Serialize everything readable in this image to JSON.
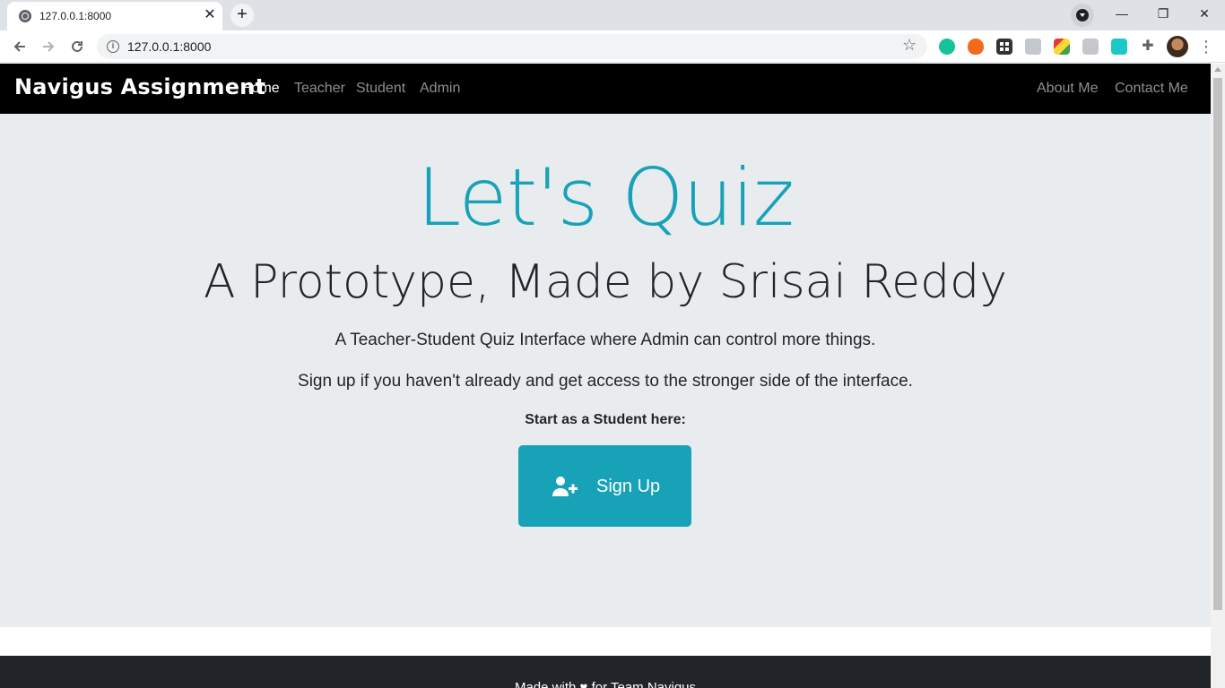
{
  "browser": {
    "tab_title": "127.0.0.1:8000",
    "tab_close": "✕",
    "new_tab": "+",
    "url": "127.0.0.1:8000",
    "window_controls": {
      "minimize": "—",
      "restore": "❐",
      "close": "✕"
    },
    "icons": {
      "back": "arrow-left-icon",
      "forward": "arrow-right-icon",
      "reload": "reload-icon",
      "info": "info-icon",
      "star": "star-icon",
      "menu": "kebab-menu-icon"
    }
  },
  "site": {
    "brand": "Navigus Assignment",
    "nav": {
      "home": "Home",
      "teacher": "Teacher",
      "student": "Student",
      "admin": "Admin",
      "about": "About Me",
      "contact": "Contact Me"
    },
    "hero": {
      "title": "Let's Quiz",
      "subtitle": "A Prototype, Made by Srisai Reddy",
      "lead1": "A Teacher-Student Quiz Interface where Admin can control more things.",
      "lead2": "Sign up if you haven't already and get access to the stronger side of the interface.",
      "start_label": "Start as a Student here:",
      "signup_label": "Sign Up"
    },
    "footer": {
      "text": "Made with ♥ for Team Navigus"
    }
  },
  "colors": {
    "accent": "#17a2b8",
    "navbar": "#000000",
    "jumbotron": "#e9ecef",
    "footer": "#212529"
  }
}
